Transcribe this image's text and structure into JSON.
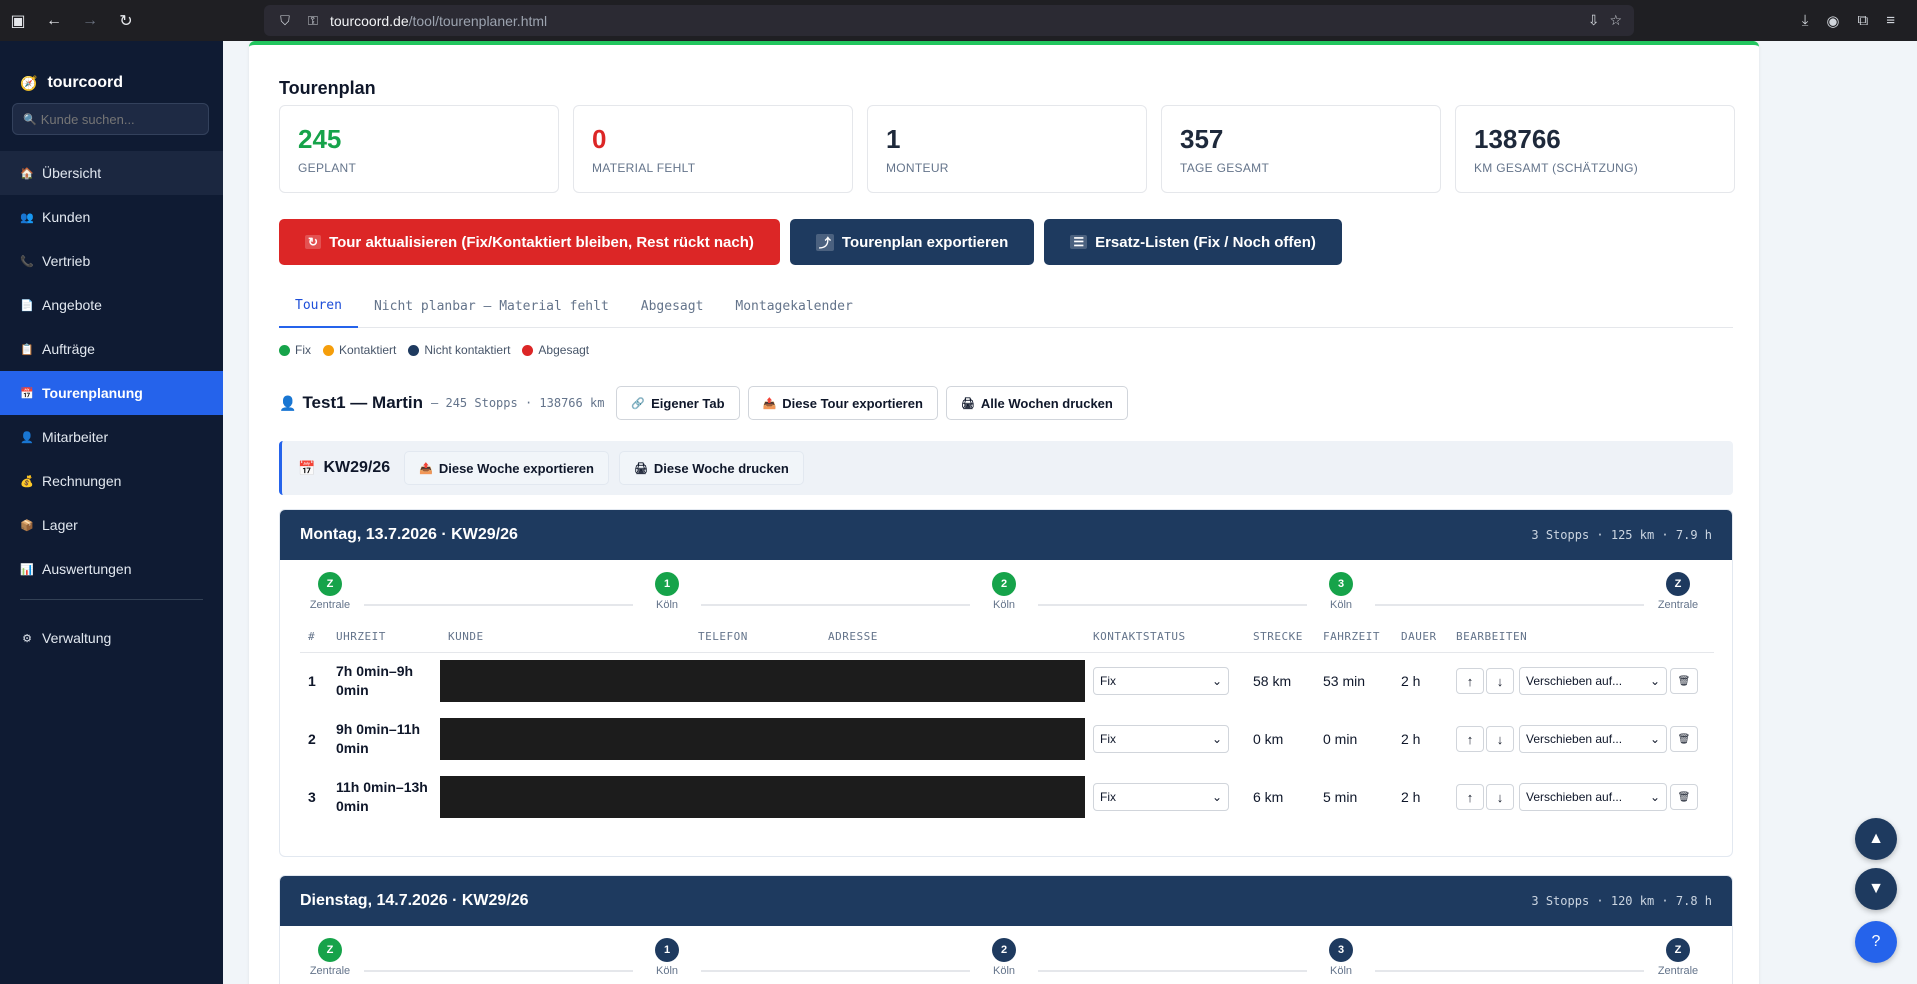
{
  "browser": {
    "url_host": "tourcoord.de",
    "url_path": "/tool/tourenplaner.html"
  },
  "sidebar": {
    "brand": "tourcoord",
    "search_placeholder": "Kunde suchen...",
    "items": [
      {
        "label": "Übersicht",
        "icon": "house-icon"
      },
      {
        "label": "Kunden",
        "icon": "people-icon"
      },
      {
        "label": "Vertrieb",
        "icon": "phone-icon"
      },
      {
        "label": "Angebote",
        "icon": "document-icon"
      },
      {
        "label": "Aufträge",
        "icon": "clipboard-icon"
      },
      {
        "label": "Tourenplanung",
        "icon": "calendar-icon"
      },
      {
        "label": "Mitarbeiter",
        "icon": "person-icon"
      },
      {
        "label": "Rechnungen",
        "icon": "money-bag-icon"
      },
      {
        "label": "Lager",
        "icon": "package-icon"
      },
      {
        "label": "Auswertungen",
        "icon": "bar-chart-icon"
      }
    ],
    "footer_item": {
      "label": "Verwaltung",
      "icon": "gear-icon"
    }
  },
  "page": {
    "title": "Tourenplan",
    "stats": [
      {
        "value": "245",
        "label": "GEPLANT"
      },
      {
        "value": "0",
        "label": "MATERIAL FEHLT"
      },
      {
        "value": "1",
        "label": "MONTEUR"
      },
      {
        "value": "357",
        "label": "TAGE GESAMT"
      },
      {
        "value": "138766",
        "label": "KM GESAMT (SCHÄTZUNG)"
      }
    ],
    "actions": {
      "update": "Tour aktualisieren (Fix/Kontaktiert bleiben, Rest rückt nach)",
      "export": "Tourenplan exportieren",
      "ersatz": "Ersatz-Listen (Fix / Noch offen)"
    },
    "tabs": [
      "Touren",
      "Nicht planbar — Material fehlt",
      "Abgesagt",
      "Montagekalender"
    ],
    "legend": [
      {
        "label": "Fix",
        "color": "#16a34a"
      },
      {
        "label": "Kontaktiert",
        "color": "#f59e0b"
      },
      {
        "label": "Nicht kontaktiert",
        "color": "#1e3a5f"
      },
      {
        "label": "Abgesagt",
        "color": "#dc2626"
      }
    ],
    "tour": {
      "title": "Test1 — Martin",
      "meta": "– 245 Stopps · 138766 km",
      "own_tab": "Eigener Tab",
      "export_tour": "Diese Tour exportieren",
      "print_all": "Alle Wochen drucken"
    },
    "week": {
      "title": "KW29/26",
      "export_week": "Diese Woche exportieren",
      "print_week": "Diese Woche drucken"
    },
    "table_headers": [
      "#",
      "UHRZEIT",
      "KUNDE",
      "TELEFON",
      "ADRESSE",
      "KONTAKTSTATUS",
      "STRECKE",
      "FAHRZEIT",
      "DAUER",
      "BEARBEITEN"
    ],
    "move_placeholder": "Verschieben auf...",
    "days": [
      {
        "title": "Montag, 13.7.2026 · KW29/26",
        "meta": "3 Stopps · 125 km · 7.9 h",
        "route": [
          {
            "mark": "Z",
            "label": "Zentrale",
            "color": "#16a34a"
          },
          {
            "mark": "1",
            "label": "Köln",
            "color": "#16a34a"
          },
          {
            "mark": "2",
            "label": "Köln",
            "color": "#16a34a"
          },
          {
            "mark": "3",
            "label": "Köln",
            "color": "#16a34a"
          },
          {
            "mark": "Z",
            "label": "Zentrale",
            "color": "#1e3a5f"
          }
        ],
        "rows": [
          {
            "n": "1",
            "time": "7h 0min–9h 0min",
            "status": "Fix",
            "distance": "58 km",
            "drive": "53 min",
            "duration": "2 h"
          },
          {
            "n": "2",
            "time": "9h 0min–11h 0min",
            "status": "Fix",
            "distance": "0 km",
            "drive": "0 min",
            "duration": "2 h"
          },
          {
            "n": "3",
            "time": "11h 0min–13h 0min",
            "status": "Fix",
            "distance": "6 km",
            "drive": "5 min",
            "duration": "2 h"
          }
        ]
      },
      {
        "title": "Dienstag, 14.7.2026 · KW29/26",
        "meta": "3 Stopps · 120 km · 7.8 h",
        "route": [
          {
            "mark": "Z",
            "label": "Zentrale",
            "color": "#16a34a"
          },
          {
            "mark": "1",
            "label": "Köln",
            "color": "#1e3a5f"
          },
          {
            "mark": "2",
            "label": "Köln",
            "color": "#1e3a5f"
          },
          {
            "mark": "3",
            "label": "Köln",
            "color": "#1e3a5f"
          },
          {
            "mark": "Z",
            "label": "Zentrale",
            "color": "#1e3a5f"
          }
        ],
        "rows": []
      }
    ]
  },
  "fabs": {
    "up": "▲",
    "down": "▼",
    "help": "?"
  }
}
